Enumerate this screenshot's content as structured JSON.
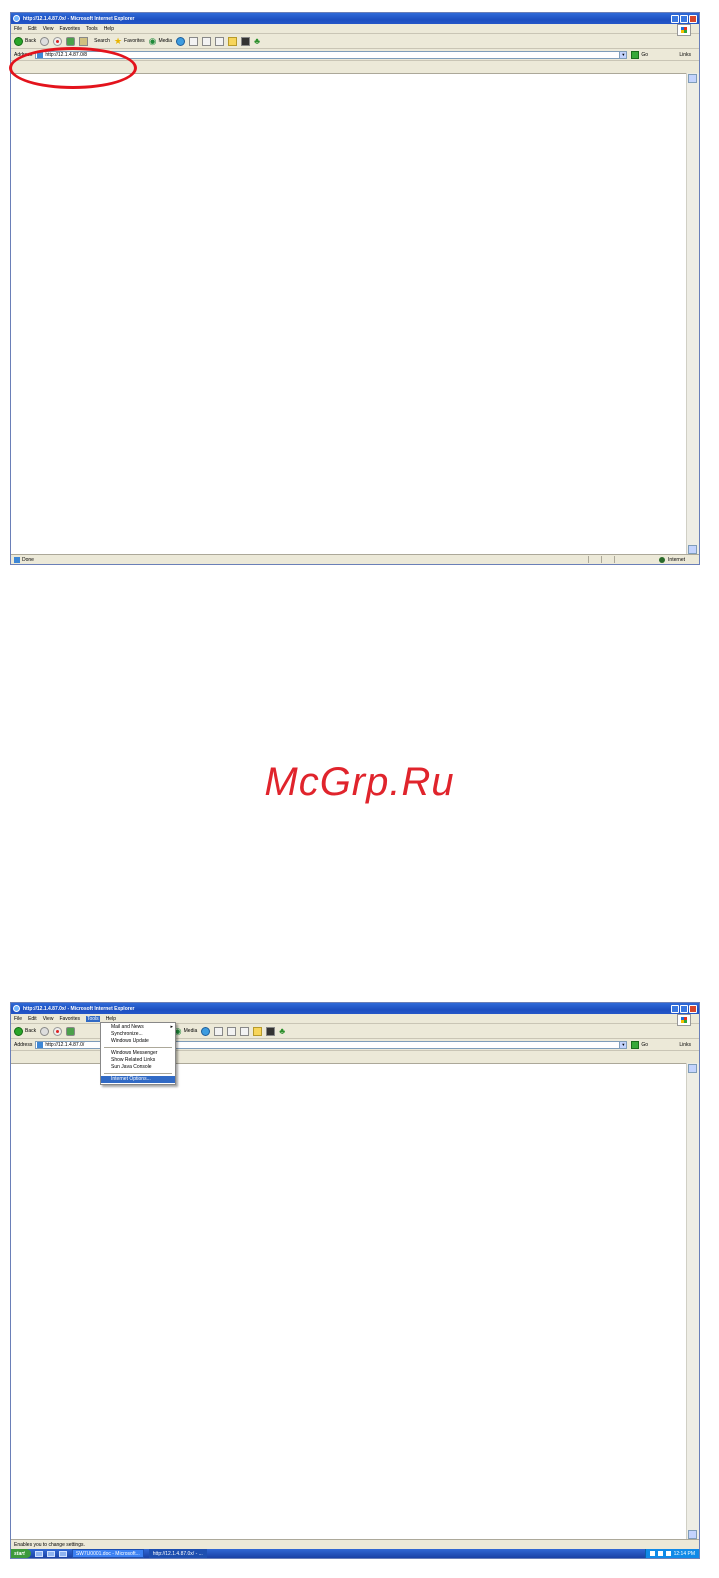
{
  "watermark": "McGrp.Ru",
  "colors": {
    "annotation": "#e3131c",
    "watermark": "#e0242c",
    "titlebar": "#1d4fc0",
    "menu_highlight": "#316ac5"
  },
  "browser": {
    "title": "http://12.1.4.87.0x/ - Microsoft Internet Explorer",
    "menu": [
      "File",
      "Edit",
      "View",
      "Favorites",
      "Tools",
      "Help"
    ],
    "toolbar": {
      "back": "Back",
      "search": "Search",
      "favorites": "Favorites",
      "media": "Media"
    },
    "address_label": "Address",
    "go": "Go",
    "links": "Links"
  },
  "window1": {
    "address": "http://12.1.4.87.0/8",
    "status": "Done",
    "zone": "Internet"
  },
  "window2": {
    "address": "http://12.1.4.87.0/",
    "status": "Enables you to change settings.",
    "tools_menu": {
      "items": [
        "Mail and News",
        "Synchronize...",
        "Windows Update",
        "Windows Messenger",
        "Show Related Links",
        "Sun Java Console",
        "Internet Options..."
      ],
      "highlighted": "Internet Options..."
    },
    "taskbar": {
      "start": "start",
      "tasks": [
        "SW7U0001.doc - Microsoft...",
        "http://12.1.4.87.0x/ - ..."
      ],
      "clock": "12:14 PM"
    }
  }
}
